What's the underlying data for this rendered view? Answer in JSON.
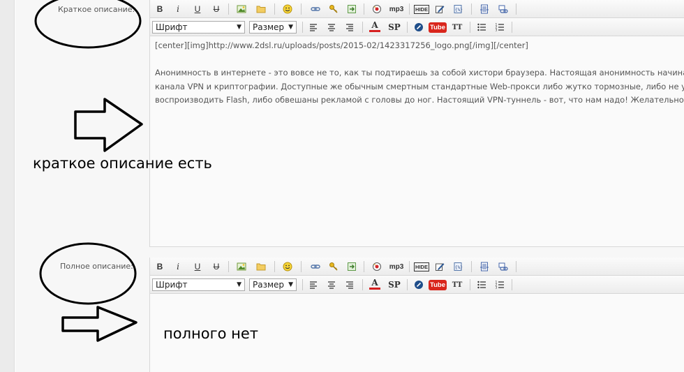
{
  "short_desc": {
    "label": "Краткое описание:",
    "toolbar": {
      "font_select": "Шрифт",
      "size_select": "Размер",
      "mp3_label": "mp3",
      "hide_label": "HIDE",
      "sp_label": "SP",
      "tube_label": "Tube",
      "tt_label": "TT"
    },
    "content": {
      "line1": "[center][img]http://www.2dsl.ru/uploads/posts/2015-02/1423317256_logo.png[/img][/center]",
      "line2": "",
      "line3": "Анонимность в интернете - это вовсе не то, как ты подтираешь за собой хистори браузера. Настоящая анонимность начинается",
      "line4": "канала VPN и криптографии. Доступные же обычным смертным стандартные Web-прокси либо жутко тормозные, либо не умеют",
      "line5": "воспроизводить Flash, либо обвешаны рекламой с головы до ног. Настоящий VPN-туннель - вот, что нам надо! Желательно еще и"
    },
    "annotation": "краткое описание есть"
  },
  "full_desc": {
    "label": "Полное описание:",
    "toolbar": {
      "font_select": "Шрифт",
      "size_select": "Размер",
      "mp3_label": "mp3",
      "hide_label": "HIDE",
      "sp_label": "SP",
      "tube_label": "Tube",
      "tt_label": "TT"
    },
    "annotation": "полного нет"
  },
  "colors": {
    "page_bg": "#f7f7f7",
    "editor_bg": "#fafafa",
    "youtube_red": "#d9261c",
    "text_gray": "#555555"
  }
}
